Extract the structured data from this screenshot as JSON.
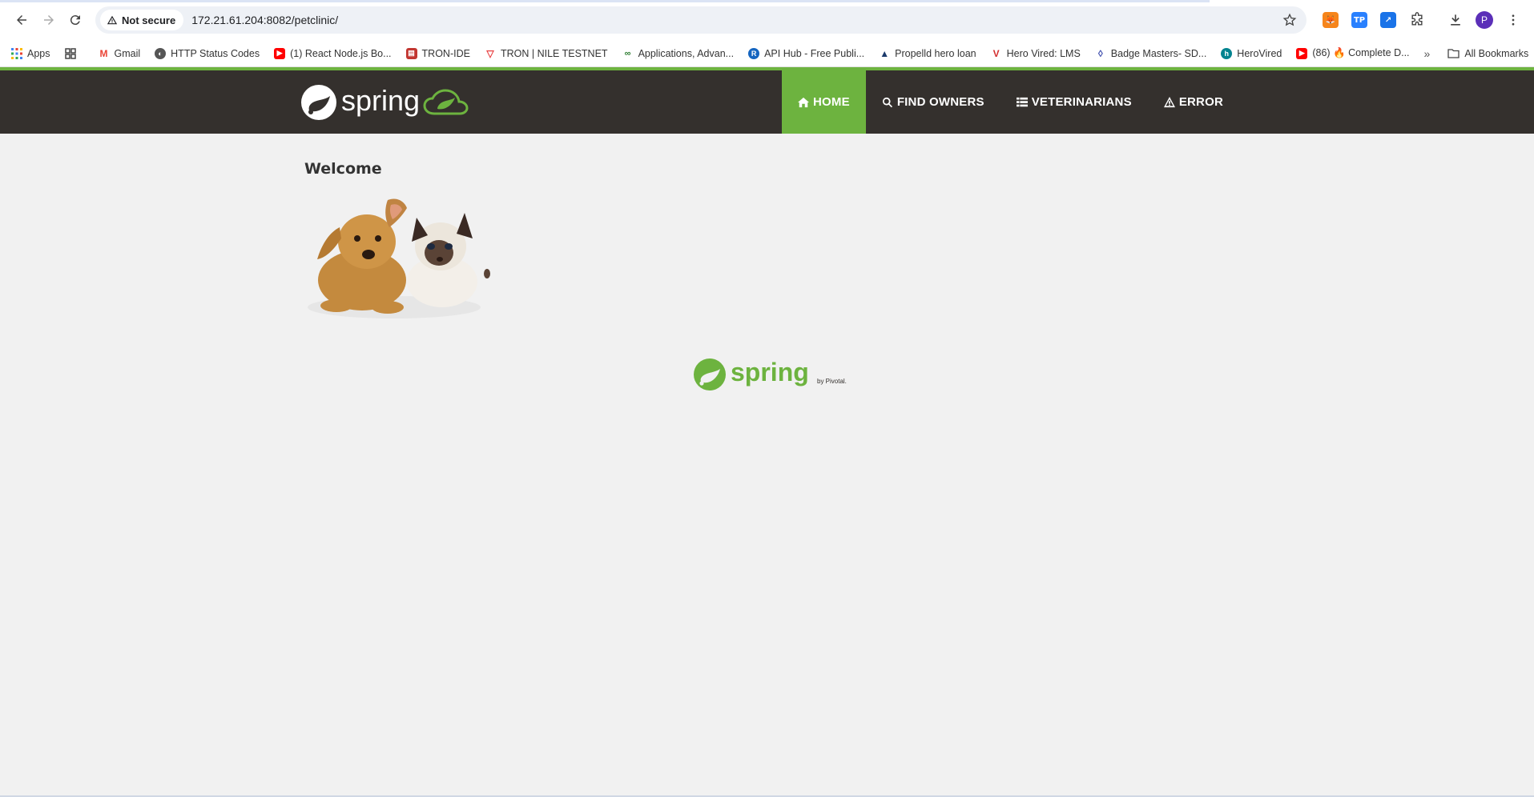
{
  "browser": {
    "security_label": "Not secure",
    "url": "172.21.61.204:8082/petclinic/",
    "profile_initial": "P",
    "extensions": [
      {
        "name": "metamask",
        "color": "#e2761b",
        "text": "🦊"
      },
      {
        "name": "tp",
        "color": "#2980fe",
        "text": "TP"
      },
      {
        "name": "tab",
        "color": "#1a73e8",
        "text": "↗"
      }
    ]
  },
  "bookmarks": [
    {
      "label": "Apps",
      "icon": "apps-grid-icon",
      "color": "#4285f4"
    },
    {
      "label": "Gmail",
      "icon": "gmail-icon",
      "color": "#ea4335"
    },
    {
      "label": "HTTP Status Codes",
      "icon": "globe-icon",
      "color": "#555555"
    },
    {
      "label": "(1) React Node.js Bo...",
      "icon": "youtube-icon",
      "color": "#ff0000"
    },
    {
      "label": "TRON-IDE",
      "icon": "tron-ide-icon",
      "color": "#c23631"
    },
    {
      "label": "TRON | NILE TESTNET",
      "icon": "tron-icon",
      "color": "#e84142"
    },
    {
      "label": "Applications, Advan...",
      "icon": "applications-icon",
      "color": "#2e7d32"
    },
    {
      "label": "API Hub - Free Publi...",
      "icon": "api-hub-icon",
      "color": "#1565c0"
    },
    {
      "label": "Propelld hero loan",
      "icon": "propelld-icon",
      "color": "#1b3a6b"
    },
    {
      "label": "Hero Vired: LMS",
      "icon": "hero-vired-icon",
      "color": "#d32f2f"
    },
    {
      "label": "Badge Masters- SD...",
      "icon": "badge-icon",
      "color": "#3949ab"
    },
    {
      "label": "HeroVired",
      "icon": "herovired-icon",
      "color": "#00838f"
    },
    {
      "label": "(86) 🔥 Complete D...",
      "icon": "youtube-icon",
      "color": "#ff0000"
    }
  ],
  "bookmarks_all": "All Bookmarks",
  "nav": {
    "home": "HOME",
    "find_owners": "FIND OWNERS",
    "veterinarians": "VETERINARIANS",
    "error": "ERROR"
  },
  "logo_text": "spring",
  "main": {
    "title": "Welcome"
  },
  "footer": {
    "logo_text": "spring",
    "by_text": "by Pivotal."
  },
  "colors": {
    "spring_green": "#6db33f",
    "navbar_bg": "#34302d",
    "page_bg": "#f1f1f1"
  }
}
